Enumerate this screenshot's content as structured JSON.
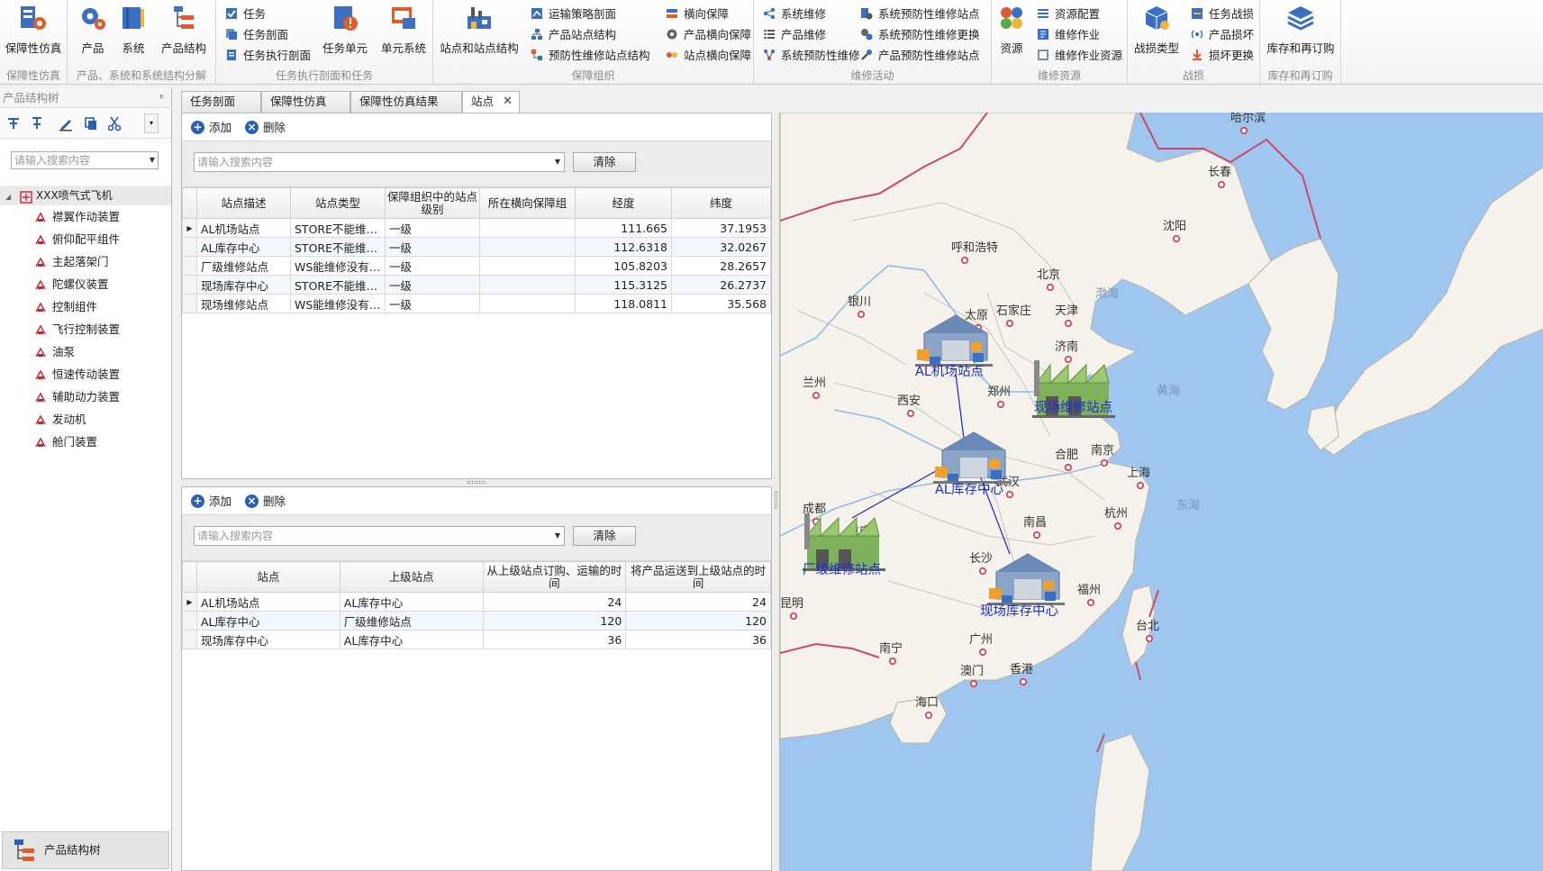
{
  "ribbon": {
    "groups": {
      "sim": "保障性仿真",
      "structure": "产品、系统和系统结构分解",
      "mission": "任务执行剖面和任务",
      "org": "保障组织",
      "maint": "维修活动",
      "resource": "维修资源",
      "battle": "战损",
      "inventory": "库存和再订购"
    },
    "buttons": {
      "sim": "保障性仿真",
      "product": "产品",
      "system": "系统",
      "product_structure": "产品结构",
      "task": "任务",
      "task_profile": "任务剖面",
      "task_exec_profile": "任务执行剖面",
      "task_unit": "任务单元",
      "unit_system": "单元系统",
      "sites": "站点和站点结构",
      "transport_profile": "运输策略剖面",
      "product_site_structure": "产品站点结构",
      "preventive_site_structure": "预防性维修站点结构",
      "lateral": "横向保障",
      "product_lateral": "产品横向保障",
      "site_lateral": "站点横向保障",
      "sys_maint": "系统维修",
      "prod_maint": "产品维修",
      "sys_prev_maint": "系统预防性维修",
      "sys_prev_site": "系统预防性维修站点",
      "sys_prev_replace": "系统预防性维修更换",
      "prod_prev_site": "产品预防性维修站点",
      "resources": "资源",
      "res_config": "资源配置",
      "maint_job": "维修作业",
      "maint_job_res": "维修作业资源",
      "battle_type": "战损类型",
      "task_battle": "任务战损",
      "prod_damage": "产品损坏",
      "damage_replace": "损坏更换",
      "inventory": "库存和再订购"
    }
  },
  "left": {
    "title": "产品结构树",
    "pin": "ᵖ",
    "search_placeholder": "请输入搜索内容",
    "root": "XXX喷气式飞机",
    "items": [
      "襟翼作动装置",
      "俯仰配平组件",
      "主起落架门",
      "陀螺仪装置",
      "控制组件",
      "飞行控制装置",
      "油泵",
      "恒速传动装置",
      "辅助动力装置",
      "发动机",
      "舱门装置"
    ],
    "bottom": "产品结构树"
  },
  "tabs": [
    "任务剖面",
    "保障性仿真",
    "保障性仿真结果",
    "站点"
  ],
  "panel_top": {
    "add": "添加",
    "delete": "删除",
    "search_placeholder": "请输入搜索内容",
    "clear": "清除",
    "columns": [
      "站点描述",
      "站点类型",
      "保障组织中的站点级别",
      "所在横向保障组",
      "经度",
      "纬度"
    ],
    "rows": [
      [
        "AL机场站点",
        "STORE不能维…",
        "一级",
        "",
        "111.665",
        "37.1953"
      ],
      [
        "AL库存中心",
        "STORE不能维…",
        "一级",
        "",
        "112.6318",
        "32.0267"
      ],
      [
        "厂级维修站点",
        "WS能维修没有…",
        "一级",
        "",
        "105.8203",
        "28.2657"
      ],
      [
        "现场库存中心",
        "STORE不能维…",
        "一级",
        "",
        "115.3125",
        "26.2737"
      ],
      [
        "现场维修站点",
        "WS能维修没有…",
        "一级",
        "",
        "118.0811",
        "35.568"
      ]
    ]
  },
  "panel_bottom": {
    "add": "添加",
    "delete": "删除",
    "search_placeholder": "请输入搜索内容",
    "clear": "清除",
    "columns": [
      "站点",
      "上级站点",
      "从上级站点订购、运输的时间",
      "将产品运送到上级站点的时间"
    ],
    "rows": [
      [
        "AL机场站点",
        "AL库存中心",
        "24",
        "24"
      ],
      [
        "AL库存中心",
        "厂级维修站点",
        "120",
        "120"
      ],
      [
        "现场库存中心",
        "AL库存中心",
        "36",
        "36"
      ]
    ]
  },
  "map": {
    "cities": [
      "哈尔滨",
      "长春",
      "沈阳",
      "呼和浩特",
      "北京",
      "天津",
      "银川",
      "太原",
      "石家庄",
      "济南",
      "兰州",
      "郑州",
      "西安",
      "合肥",
      "南京",
      "上海",
      "武汉",
      "杭州",
      "成都",
      "重庆",
      "南昌",
      "长沙",
      "福州",
      "台北",
      "昆明",
      "南宁",
      "广州",
      "澳门",
      "香港",
      "海口"
    ],
    "seas": [
      "渤海",
      "黄海",
      "东海"
    ],
    "stations": [
      "AL机场站点",
      "现场维修站点",
      "AL库存中心",
      "厂级维修站点",
      "现场库存中心"
    ]
  },
  "colors": {
    "accent": "#2b5fb3",
    "station_label": "#1b2fd0",
    "link": "#2323d6",
    "sea": "#9fc6ee",
    "land": "#f4f2ea"
  }
}
